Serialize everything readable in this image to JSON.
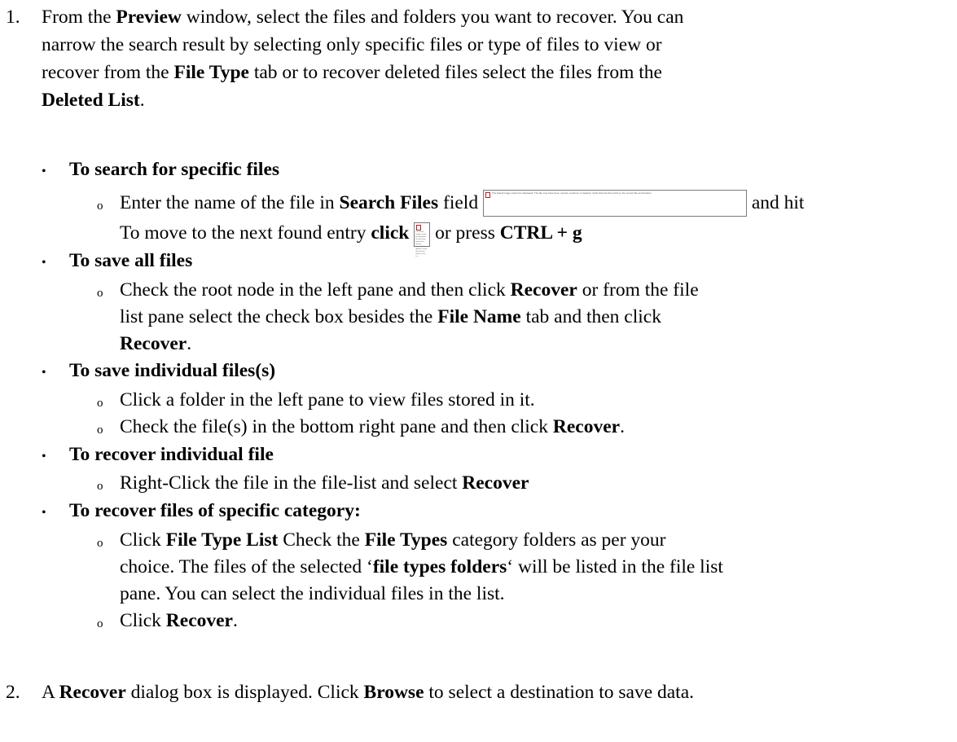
{
  "step1": {
    "number": "1.",
    "l1a": "From the ",
    "l1b": "Preview",
    "l1c": " window, select the files and folders you want to recover. You can",
    "l2": "narrow the search result by selecting only specific files or type of files to view or",
    "l3a": "recover from the ",
    "l3b": "File Type",
    "l3c": " tab or to recover deleted files select the files from the",
    "l4a": "Deleted List",
    "l4b": "."
  },
  "bullet_char": "•",
  "sub_bullet_char": "o",
  "search": {
    "heading": "To search for specific files",
    "i1a": "Enter the name of the file in ",
    "i1b": "Search Files",
    "i1c": " field ",
    "i1d": " and hit",
    "i2a": "To move to the next found entry ",
    "i2b": "click",
    "i2c": " or press ",
    "i2d": "CTRL + g",
    "broken_image_text": "The linked image cannot be displayed. The file may have been moved, renamed, or deleted. Verify that the link points to the correct file and location.",
    "small_image_text": "The linked image cannot be displayed. The file may have been moved, renamed, or deleted. Verify that the link points to the co..."
  },
  "save_all": {
    "heading": "To save all files",
    "i1a": "Check the root node in the left pane and then click ",
    "i1b": "Recover",
    "i1c": " or from the file",
    "i2a": "list pane select the check box besides the ",
    "i2b": "File Name",
    "i2c": " tab and then click",
    "i3a": "Recover",
    "i3b": "."
  },
  "save_individual": {
    "heading": "To save individual files(s)",
    "i1": "Click a folder in the left pane to view files stored in it.",
    "i2a": "Check the file(s) in the bottom right pane and then click ",
    "i2b": "Recover",
    "i2c": "."
  },
  "recover_individual": {
    "heading": "To recover individual file",
    "i1a": "Right-Click the file in the file-list and select ",
    "i1b": "Recover"
  },
  "recover_category": {
    "heading": "To recover files of specific category:",
    "i1a": "Click ",
    "i1b": "File Type List",
    "i1c": " Check the ",
    "i1d": "File Types",
    "i1e": " category folders as per your",
    "i2a": "choice. The files of the selected ‘",
    "i2b": "file types folders",
    "i2c": "‘ will be listed in the file list",
    "i3": "pane. You can select the individual files in the list.",
    "i4a": "Click ",
    "i4b": "Recover",
    "i4c": "."
  },
  "step2": {
    "number": "2.",
    "a": "A ",
    "b": "Recover",
    "c": " dialog box is displayed. Click ",
    "d": "Browse",
    "e": " to  select a destination to save data."
  }
}
